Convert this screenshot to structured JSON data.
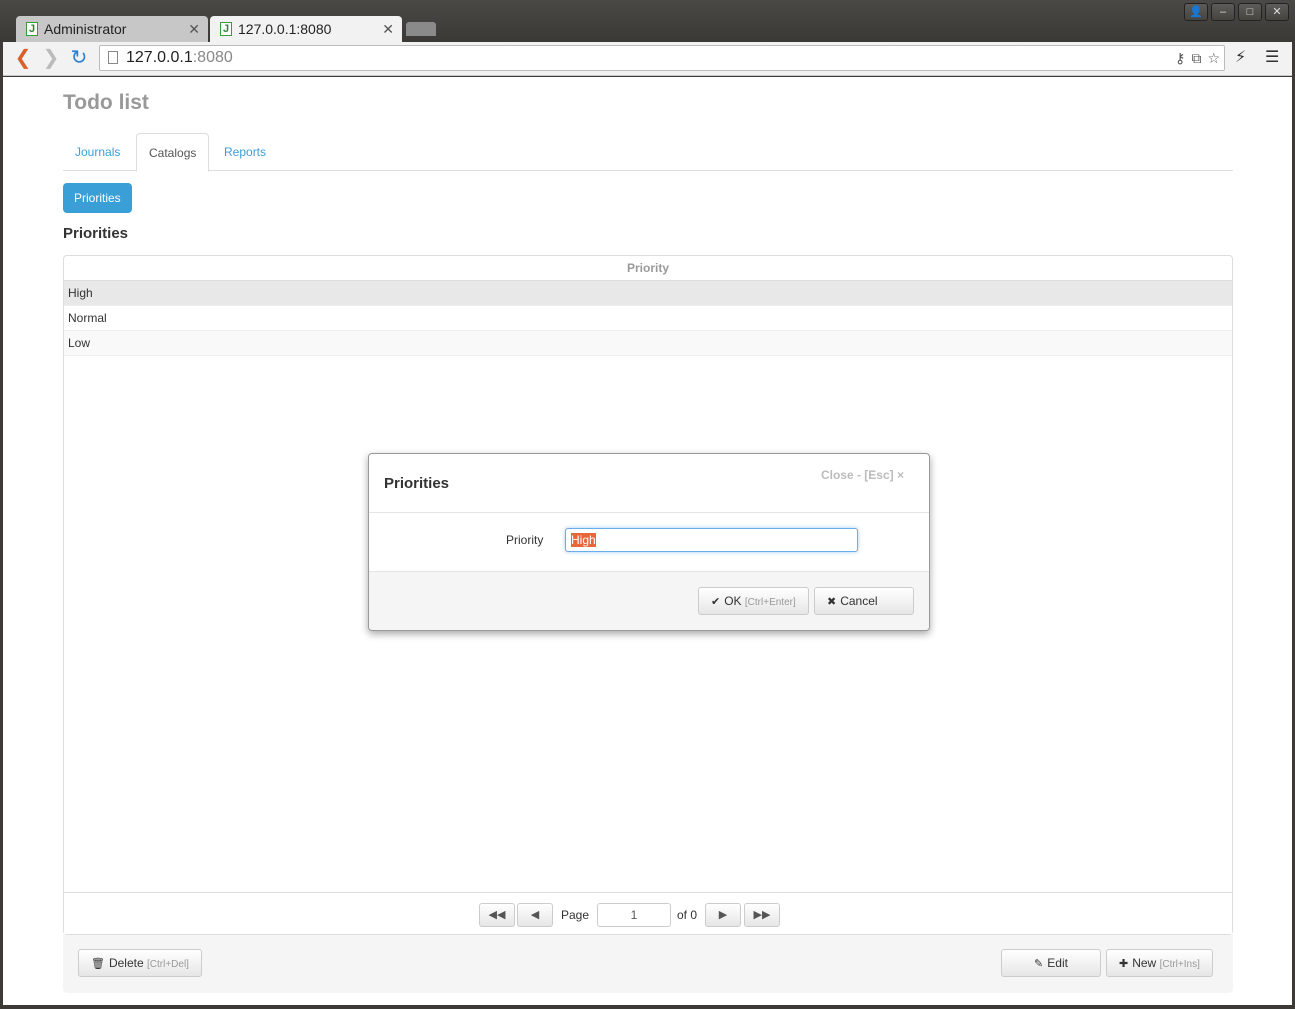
{
  "browser": {
    "tabs": [
      {
        "label": "Administrator",
        "favicon": "J"
      },
      {
        "label": "127.0.0.1:8080",
        "favicon": "J"
      }
    ],
    "url_host": "127.0.0.1",
    "url_port": ":8080"
  },
  "app": {
    "title": "Todo list",
    "nav_tabs": [
      {
        "label": "Journals"
      },
      {
        "label": "Catalogs",
        "active": true
      },
      {
        "label": "Reports"
      }
    ],
    "catalog_button": "Priorities",
    "section_title": "Priorities"
  },
  "grid": {
    "column": "Priority",
    "rows": [
      "High",
      "Normal",
      "Low"
    ],
    "pager": {
      "page_label": "Page",
      "page_value": "1",
      "of_label": "of 0"
    }
  },
  "footer": {
    "delete_label": "Delete",
    "delete_hint": "[Ctrl+Del]",
    "edit_label": "Edit",
    "new_label": "New",
    "new_hint": "[Ctrl+Ins]"
  },
  "modal": {
    "title": "Priorities",
    "close_label": "Close - [Esc] ×",
    "field_label": "Priority",
    "field_value": "High",
    "ok_label": "OK",
    "ok_hint": "[Ctrl+Enter]",
    "cancel_label": "Cancel"
  },
  "colors": {
    "accent": "#3a9fd6",
    "selection": "#e8663a"
  }
}
